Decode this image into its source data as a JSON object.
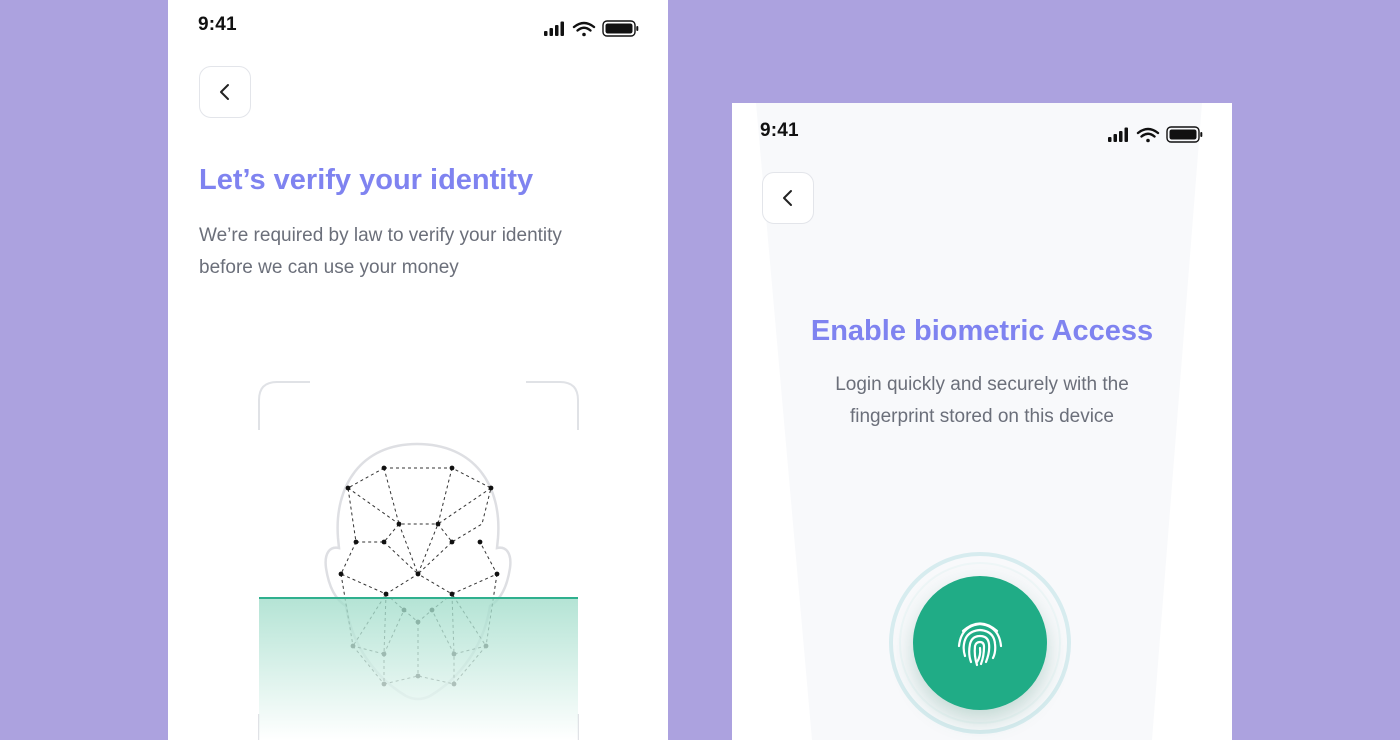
{
  "left_screen": {
    "status_time": "9:41",
    "title": "Let’s verify your identity",
    "subtitle_line1": "We’re required by law to verify your identity",
    "subtitle_line2": "before we can use your money"
  },
  "right_screen": {
    "status_time": "9:41",
    "title": "Enable biometric Access",
    "subtitle_line1": "Login quickly and securely with the",
    "subtitle_line2": "fingerprint stored on this device"
  },
  "colors": {
    "background": "#aca2df",
    "title_accent": "#7f83f0",
    "brand_green": "#20ac86",
    "scan_line": "#2fb08e"
  },
  "icons": [
    "cellular-signal-icon",
    "wifi-icon",
    "battery-icon",
    "chevron-left-icon",
    "face-mesh-icon",
    "fingerprint-icon"
  ]
}
